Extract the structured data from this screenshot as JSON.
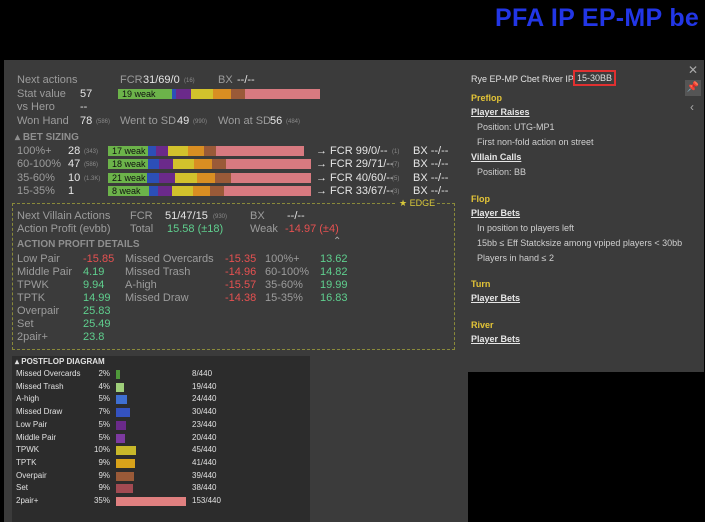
{
  "banner": "PFA IP EP-MP be",
  "top": {
    "next_actions_label": "Next actions",
    "fcr_label": "FCR",
    "next_actions_fcr": "31/69/0",
    "next_actions_fcr_sub": "(16)",
    "bx_label": "BX",
    "next_actions_bx": "--/--",
    "stat_value_label": "Stat value",
    "stat_value": "57",
    "stat_bar_text": "19 weak",
    "vs_hero_label": "vs Hero",
    "vs_hero": "--",
    "won_hand_label": "Won Hand",
    "won_hand": "78",
    "won_hand_sub": "(586)",
    "wtsd_label": "Went to SD",
    "wtsd": "49",
    "wtsd_sub": "(990)",
    "wsd_label": "Won at SD",
    "wsd": "56",
    "wsd_sub": "(484)"
  },
  "bet_sizing": {
    "header": "BET SIZING",
    "rows": [
      {
        "label": "100%+",
        "val": "28",
        "sub": "(343)",
        "bar_text": "17 weak",
        "fcr": "→ FCR 99/0/--",
        "fcr_sub": "(1)",
        "bx": "BX --/--"
      },
      {
        "label": "60-100%",
        "val": "47",
        "sub": "(586)",
        "bar_text": "18 weak",
        "fcr": "→ FCR 29/71/--",
        "fcr_sub": "(7)",
        "bx": "BX --/--"
      },
      {
        "label": "35-60%",
        "val": "10",
        "sub": "(1.3K)",
        "bar_text": "21 weak",
        "fcr": "→ FCR 40/60/--",
        "fcr_sub": "(5)",
        "bx": "BX --/--"
      },
      {
        "label": "15-35%",
        "val": "1",
        "sub": "",
        "bar_text": "8 weak",
        "fcr": "→ FCR 33/67/--",
        "fcr_sub": "(3)",
        "bx": "BX --/--"
      }
    ]
  },
  "edge": {
    "tag": "★ EDGE",
    "next_villain_label": "Next Villain Actions",
    "fcr_label": "FCR",
    "fcr": "51/47/15",
    "fcr_sub": "(930)",
    "bx_label": "BX",
    "bx": "--/--",
    "action_profit_label": "Action Profit (evbb)",
    "total_label": "Total",
    "total": "15.58 (±18)",
    "weak_label": "Weak",
    "weak": "-14.97 (±4)",
    "details_header": "ACTION PROFIT DETAILS",
    "col1": [
      {
        "k": "Low Pair",
        "v": "-15.85"
      },
      {
        "k": "Middle Pair",
        "v": "4.19"
      },
      {
        "k": "TPWK",
        "v": "9.94"
      },
      {
        "k": "TPTK",
        "v": "14.99"
      },
      {
        "k": "Overpair",
        "v": "25.83"
      },
      {
        "k": "Set",
        "v": "25.49"
      },
      {
        "k": "2pair+",
        "v": "23.8"
      }
    ],
    "col2": [
      {
        "k": "Missed Overcards",
        "v": "-15.35"
      },
      {
        "k": "Missed Trash",
        "v": "-14.96"
      },
      {
        "k": "A-high",
        "v": "-15.57"
      },
      {
        "k": "Missed Draw",
        "v": "-14.38"
      }
    ],
    "col3": [
      {
        "k": "100%+",
        "v": "13.62"
      },
      {
        "k": "60-100%",
        "v": "14.82"
      },
      {
        "k": "35-60%",
        "v": "19.99"
      },
      {
        "k": "15-35%",
        "v": "16.83"
      }
    ]
  },
  "postflop": {
    "header": "POSTFLOP DIAGRAM",
    "rows": [
      {
        "name": "Missed Overcards",
        "pct": "2%",
        "count": "8/440",
        "frac": 0.02,
        "color": "#4f9a3a"
      },
      {
        "name": "Missed Trash",
        "pct": "4%",
        "count": "19/440",
        "frac": 0.04,
        "color": "#9fcf7a"
      },
      {
        "name": "A-high",
        "pct": "5%",
        "count": "24/440",
        "frac": 0.055,
        "color": "#3f6fd1"
      },
      {
        "name": "Missed Draw",
        "pct": "7%",
        "count": "30/440",
        "frac": 0.068,
        "color": "#3452c0"
      },
      {
        "name": "Low Pair",
        "pct": "5%",
        "count": "23/440",
        "frac": 0.052,
        "color": "#6b2a8a"
      },
      {
        "name": "Middle Pair",
        "pct": "5%",
        "count": "20/440",
        "frac": 0.045,
        "color": "#7d3aa0"
      },
      {
        "name": "TPWK",
        "pct": "10%",
        "count": "45/440",
        "frac": 0.1,
        "color": "#c8b82a"
      },
      {
        "name": "TPTK",
        "pct": "9%",
        "count": "41/440",
        "frac": 0.093,
        "color": "#d8a21a"
      },
      {
        "name": "Overpair",
        "pct": "9%",
        "count": "39/440",
        "frac": 0.089,
        "color": "#9a5a38"
      },
      {
        "name": "Set",
        "pct": "9%",
        "count": "38/440",
        "frac": 0.086,
        "color": "#a24a52"
      },
      {
        "name": "2pair+",
        "pct": "35%",
        "count": "153/440",
        "frac": 0.35,
        "color": "#e08080"
      }
    ]
  },
  "right": {
    "title": "Rye EP-MP Cbet River IP",
    "range": "15-30BB",
    "preflop": "Preflop",
    "player_raises": "Player Raises",
    "position": "Position: UTG-MP1",
    "first_nonfold": "First non-fold action on street",
    "villain_calls": "Villain Calls",
    "position_bb": "Position: BB",
    "flop": "Flop",
    "player_bets": "Player Bets",
    "in_position": "In position to players left",
    "stack": "15bb ≤ Eff Statcksize among vpiped players < 30bb",
    "players": "Players in hand ≤ 2",
    "turn": "Turn",
    "turn_bets": "Player Bets",
    "river": "River",
    "river_bets": "Player Bets"
  }
}
